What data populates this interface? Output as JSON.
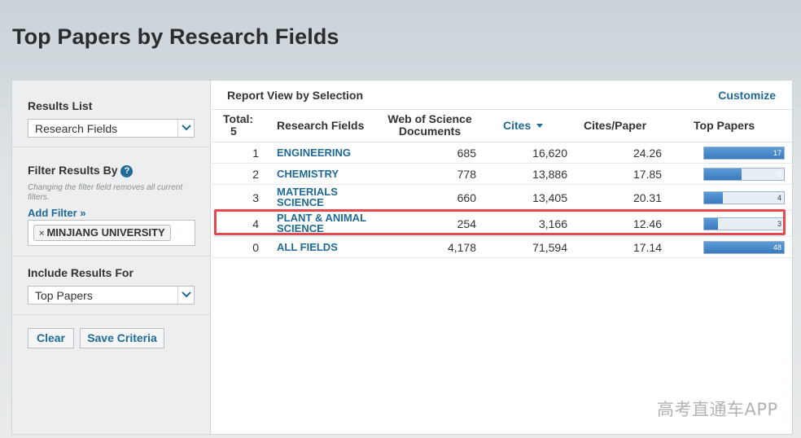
{
  "page": {
    "title": "Top Papers by Research Fields"
  },
  "sidebar": {
    "results_list_label": "Results List",
    "results_list_value": "Research Fields",
    "filter_label": "Filter Results By",
    "help_icon_glyph": "?",
    "filter_hint": "Changing the filter field removes all current filters.",
    "add_filter": "Add Filter »",
    "active_filter": "MINJIANG UNIVERSITY",
    "chip_close_glyph": "×",
    "include_label": "Include Results For",
    "include_value": "Top Papers",
    "clear_button": "Clear",
    "save_button": "Save Criteria"
  },
  "report": {
    "heading": "Report View by Selection",
    "customize": "Customize",
    "columns": {
      "total_label": "Total:",
      "total_value": "5",
      "field": "Research Fields",
      "docs_line1": "Web of Science",
      "docs_line2": "Documents",
      "cites": "Cites",
      "cites_per_paper": "Cites/Paper",
      "top_papers": "Top Papers"
    },
    "rows": [
      {
        "rank": "1",
        "field": "ENGINEERING",
        "docs": "685",
        "cites": "16,620",
        "cpp": "24.26",
        "top": "17",
        "top_value": 17
      },
      {
        "rank": "2",
        "field": "CHEMISTRY",
        "docs": "778",
        "cites": "13,886",
        "cpp": "17.85",
        "top": "8",
        "top_value": 8
      },
      {
        "rank": "3",
        "field": "MATERIALS SCIENCE",
        "docs": "660",
        "cites": "13,405",
        "cpp": "20.31",
        "top": "4",
        "top_value": 4
      },
      {
        "rank": "4",
        "field": "PLANT & ANIMAL SCIENCE",
        "docs": "254",
        "cites": "3,166",
        "cpp": "12.46",
        "top": "3",
        "top_value": 3
      },
      {
        "rank": "0",
        "field": "ALL FIELDS",
        "docs": "4,178",
        "cites": "71,594",
        "cpp": "17.14",
        "top": "48",
        "top_value": 48
      }
    ],
    "top_papers_max": 17,
    "highlight_color": "#e5484d"
  },
  "watermark": "高考直通车APP",
  "colors": {
    "link": "#1f6a96",
    "bar": "#3a7bc0"
  }
}
